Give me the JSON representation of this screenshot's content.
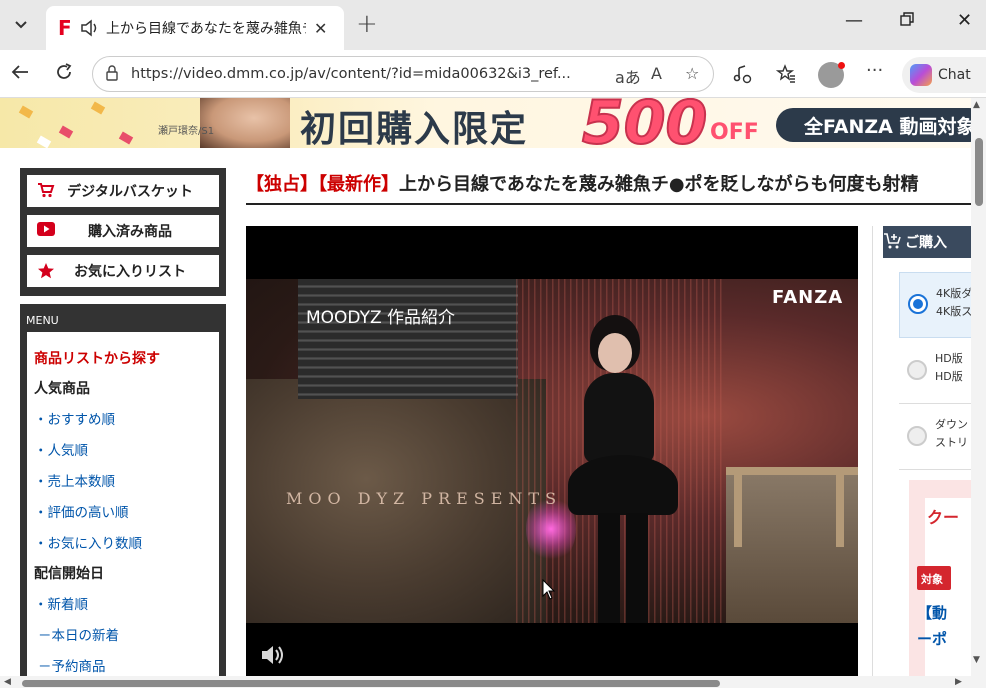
{
  "browser": {
    "tab_title": "上から目線であなたを蔑み雑魚チ",
    "url": "https://video.dmm.co.jp/av/content/?id=mida00632&i3_ref...",
    "chat_label": "Chat",
    "favicon_letter": "F",
    "read_aloud": "A",
    "immersive": "aあ"
  },
  "banner": {
    "credit": "瀬戸環奈/S1",
    "headline": "初回購入限定",
    "amount": "500",
    "off": "OFF",
    "pill": "全FANZA 動画対象"
  },
  "sidebar": {
    "quick": [
      {
        "label": "デジタルバスケット",
        "icon": "cart-icon"
      },
      {
        "label": "購入済み商品",
        "icon": "play-icon"
      },
      {
        "label": "お気に入りリスト",
        "icon": "star-icon"
      }
    ],
    "menu_header": "MENU",
    "menu_red": "商品リストから探す",
    "sec_popular": "人気商品",
    "popular_links": [
      "・おすすめ順",
      "・人気順",
      "・売上本数順",
      "・評価の高い順",
      "・お気に入り数順"
    ],
    "sec_release": "配信開始日",
    "release_links": [
      "・新着順",
      "－本日の新着",
      "－予約商品"
    ]
  },
  "main": {
    "title_tag1": "【独占】",
    "title_tag2": "【最新作】",
    "title_text": "上から目線であなたを蔑み雑魚チ●ポを貶しながらも何度も射精"
  },
  "video": {
    "label": "MOODYZ 作品紹介",
    "logo": "FANZA",
    "watermark": "MOO DYZ PRESENTS"
  },
  "purchase": {
    "header": "ご購入",
    "options": [
      {
        "line1": "4K版ダ",
        "line2": "4K版ス"
      },
      {
        "line1": "HD版",
        "line2": "HD版"
      },
      {
        "line1": "ダウン",
        "line2": "ストリ"
      }
    ],
    "coupon_title": "クー",
    "coupon_badge": "対象",
    "coupon_line1": "【動",
    "coupon_line2": "ーポ"
  },
  "colors": {
    "accent_red": "#c00000",
    "link_blue": "#0055aa",
    "dark_panel": "#333333"
  }
}
